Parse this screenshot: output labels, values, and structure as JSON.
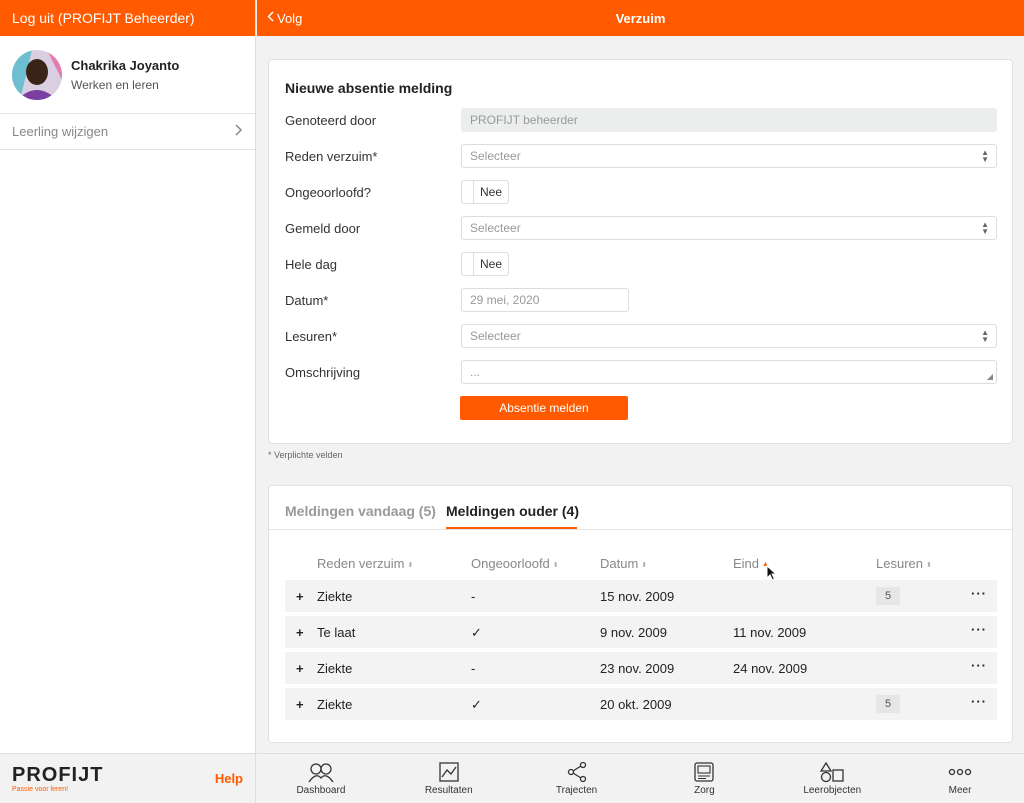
{
  "sidebar": {
    "logout_label": "Log uit (PROFIJT Beheerder)",
    "user_name": "Chakrika Joyanto",
    "user_subtitle": "Werken en leren",
    "change_student_label": "Leerling wijzigen",
    "logo_text": "PROFIJT",
    "logo_tagline": "Passie voor leren!",
    "help_label": "Help"
  },
  "header": {
    "back_label": "Volg",
    "title": "Verzuim"
  },
  "form": {
    "title": "Nieuwe absentie melding",
    "rows": [
      {
        "label": "Genoteerd door",
        "value": "PROFIJT beheerder"
      },
      {
        "label": "Reden verzuim*",
        "value": "Selecteer"
      },
      {
        "label": "Ongeoorloofd?",
        "value": "Nee"
      },
      {
        "label": "Gemeld door",
        "value": "Selecteer"
      },
      {
        "label": "Hele dag",
        "value": "Nee"
      },
      {
        "label": "Datum*",
        "value": "29 mei, 2020"
      },
      {
        "label": "Lesuren*",
        "value": "Selecteer"
      },
      {
        "label": "Omschrijving",
        "value": "..."
      }
    ],
    "submit_label": "Absentie melden",
    "required_note": "* Verplichte velden"
  },
  "list": {
    "tabs": [
      {
        "label": "Meldingen vandaag (5)",
        "active": false
      },
      {
        "label": "Meldingen ouder (4)",
        "active": true
      }
    ],
    "columns": [
      "Reden verzuim",
      "Ongeoorloofd",
      "Datum",
      "Eind",
      "Lesuren"
    ],
    "rows": [
      {
        "expand": "+",
        "reason": "Ziekte",
        "unauthorized": "-",
        "date": "15 nov. 2009",
        "end": "",
        "hours": "5",
        "more": "···"
      },
      {
        "expand": "+",
        "reason": "Te laat",
        "unauthorized": "✓",
        "date": "9 nov. 2009",
        "end": "11 nov. 2009",
        "hours": "",
        "more": "···"
      },
      {
        "expand": "+",
        "reason": "Ziekte",
        "unauthorized": "-",
        "date": "23 nov. 2009",
        "end": "24 nov. 2009",
        "hours": "",
        "more": "···"
      },
      {
        "expand": "+",
        "reason": "Ziekte",
        "unauthorized": "✓",
        "date": "20 okt. 2009",
        "end": "",
        "hours": "5",
        "more": "···"
      }
    ]
  },
  "nav": {
    "items": [
      {
        "label": "Dashboard",
        "icon": "dashboard-icon"
      },
      {
        "label": "Resultaten",
        "icon": "chart-icon"
      },
      {
        "label": "Trajecten",
        "icon": "share-icon"
      },
      {
        "label": "Zorg",
        "icon": "care-icon"
      },
      {
        "label": "Leerobjecten",
        "icon": "shapes-icon"
      },
      {
        "label": "Meer",
        "icon": "more-icon"
      }
    ]
  },
  "colors": {
    "accent": "#ff5a00"
  }
}
